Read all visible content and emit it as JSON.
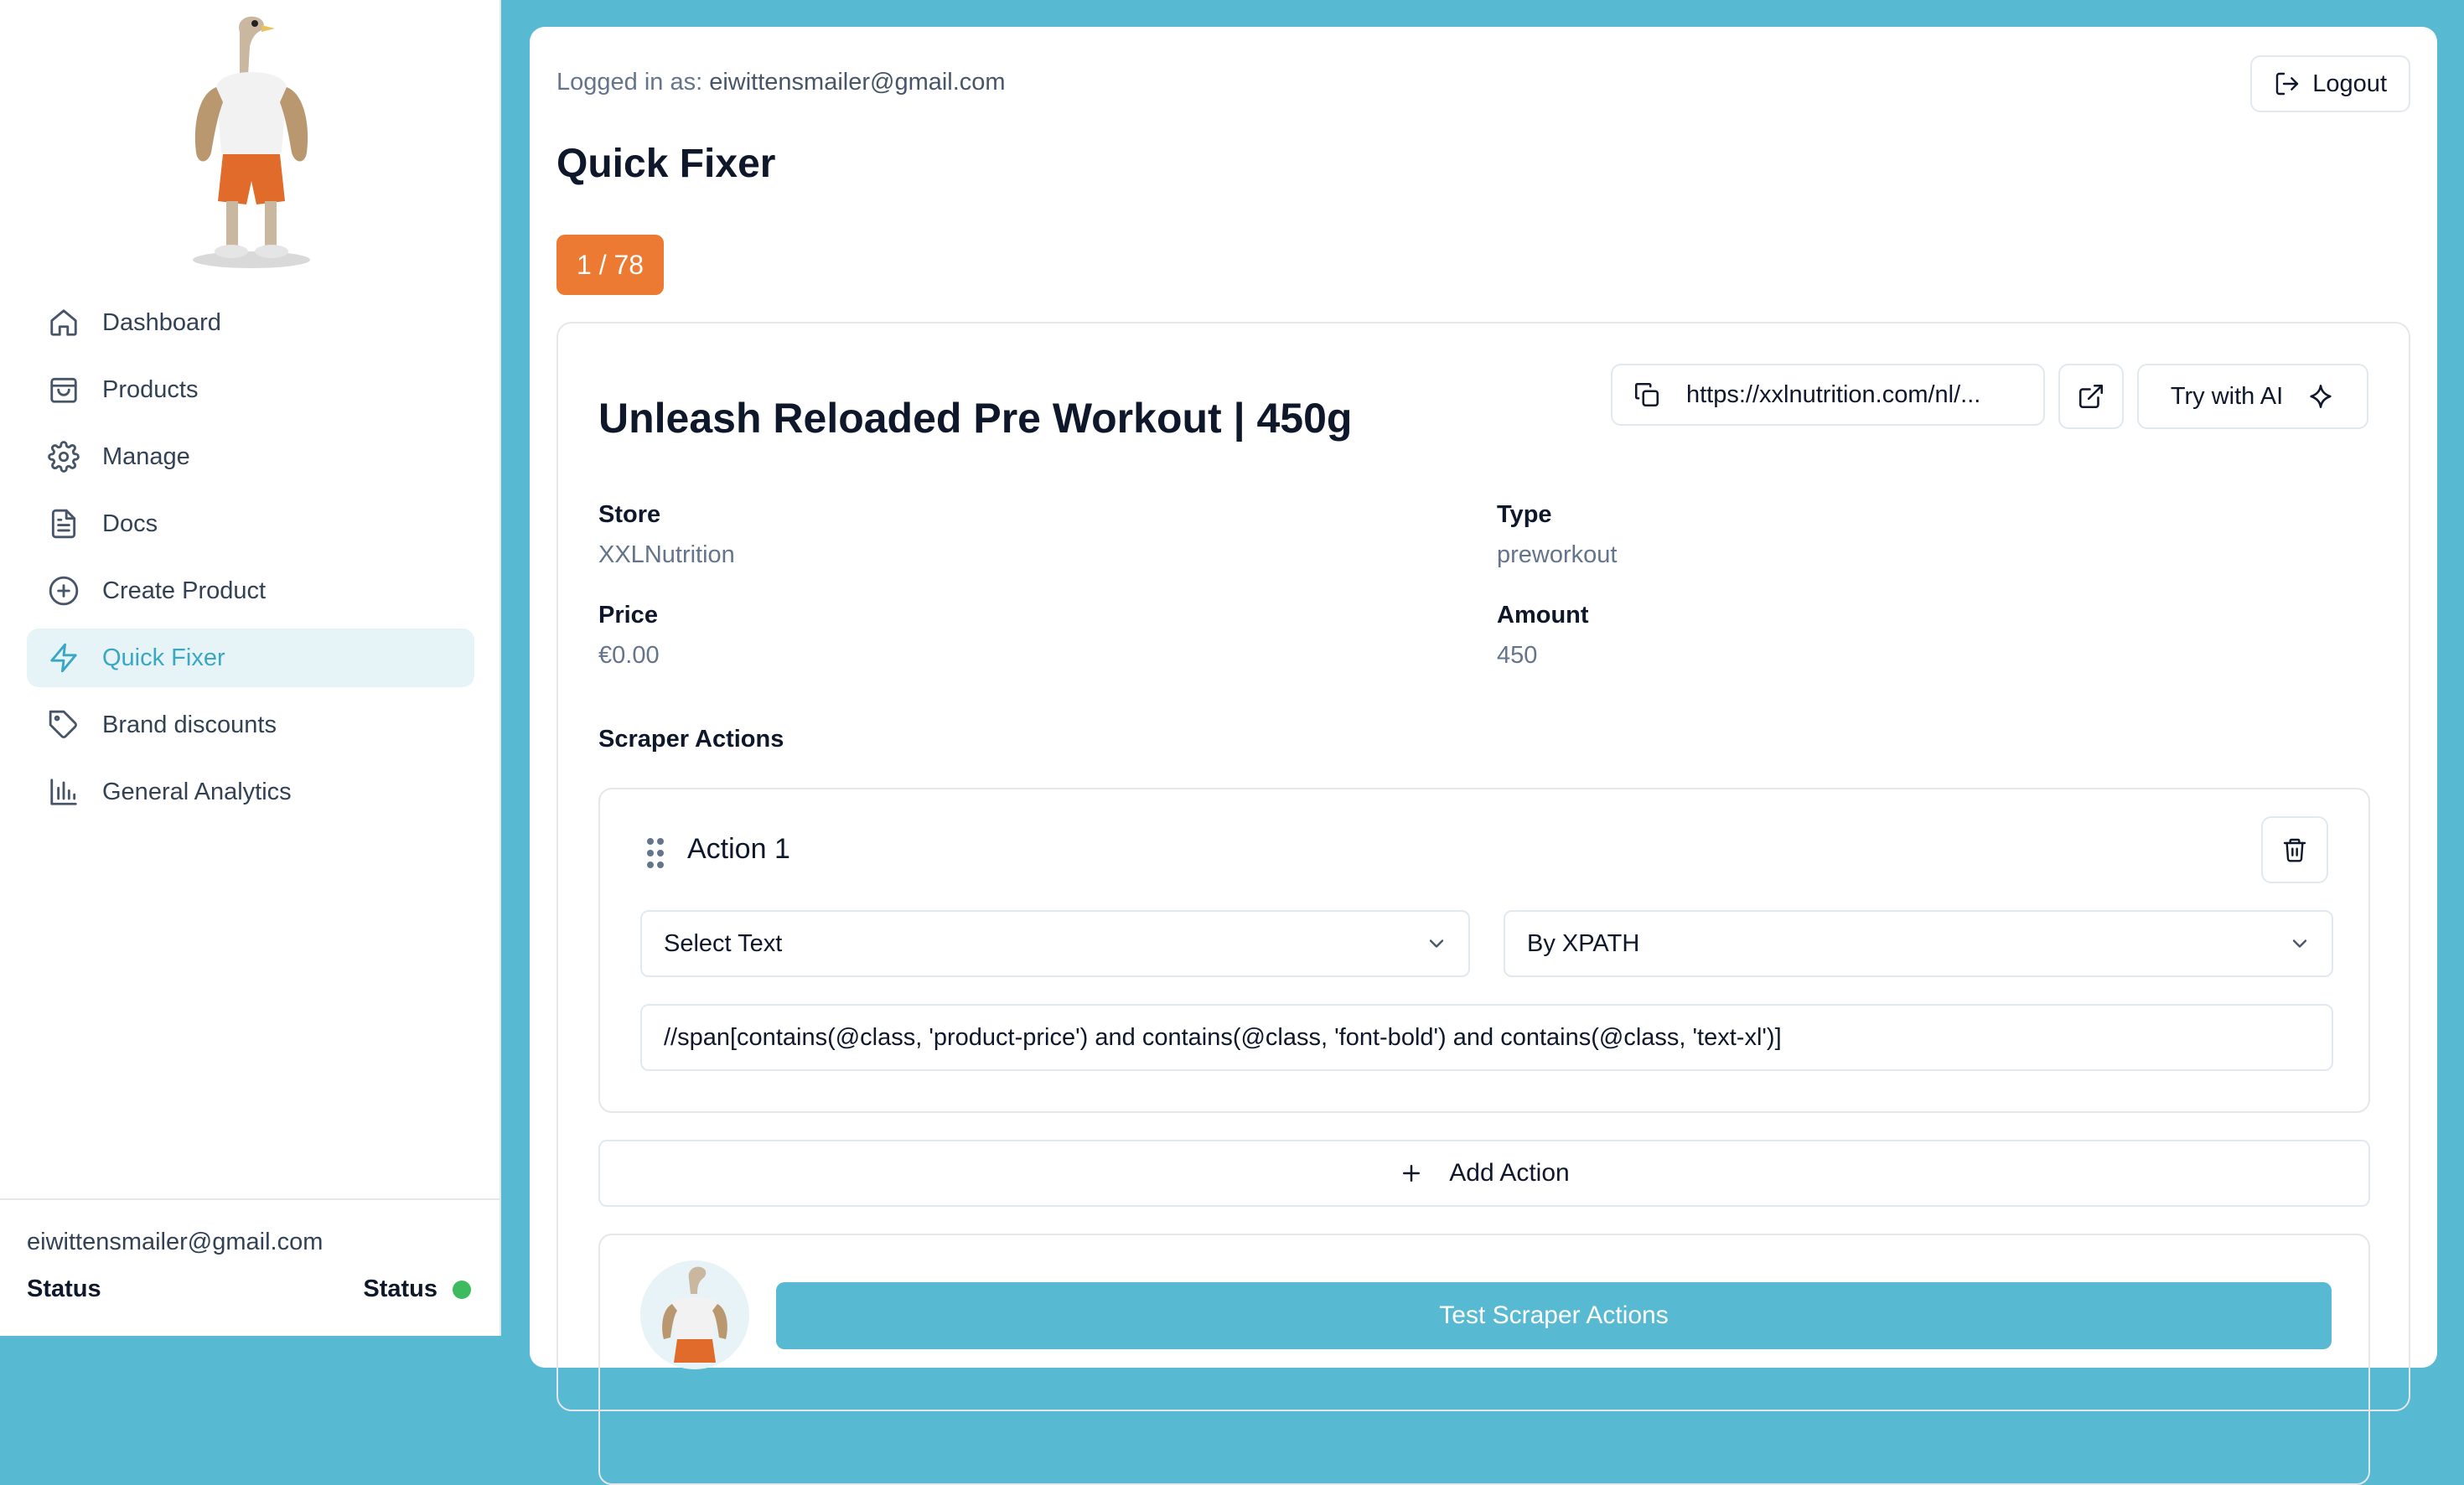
{
  "sidebar": {
    "logo_alt": "ostrich bodybuilder mascot",
    "items": [
      {
        "label": "Dashboard",
        "icon": "home-icon"
      },
      {
        "label": "Products",
        "icon": "shopping-bag-icon"
      },
      {
        "label": "Manage",
        "icon": "gear-icon"
      },
      {
        "label": "Docs",
        "icon": "document-icon"
      },
      {
        "label": "Create Product",
        "icon": "plus-circle-icon"
      },
      {
        "label": "Quick Fixer",
        "icon": "lightning-icon",
        "active": true
      },
      {
        "label": "Brand discounts",
        "icon": "tag-icon"
      },
      {
        "label": "General Analytics",
        "icon": "bar-chart-icon"
      }
    ],
    "footer": {
      "email": "eiwittensmailer@gmail.com",
      "status_left": "Status",
      "status_right": "Status",
      "status_color": "#3dbb5e"
    }
  },
  "header": {
    "logged_prefix": "Logged in as:",
    "logged_email": "eiwittensmailer@gmail.com",
    "logout_label": "Logout"
  },
  "page": {
    "title": "Quick Fixer",
    "counter": "1 / 78",
    "counter_color": "#ec7a33"
  },
  "product": {
    "title": "Unleash Reloaded Pre Workout | 450g",
    "url": "https://xxlnutrition.com/nl/...",
    "try_ai_label": "Try with AI",
    "store_label": "Store",
    "store_value": "XXLNutrition",
    "type_label": "Type",
    "type_value": "preworkout",
    "price_label": "Price",
    "price_value": "€0.00",
    "amount_label": "Amount",
    "amount_value": "450"
  },
  "scraper": {
    "section_label": "Scraper Actions",
    "actions": [
      {
        "title": "Action 1",
        "action_type": "Select Text",
        "selector_type": "By XPATH",
        "selector": "//span[contains(@class, 'product-price') and contains(@class, 'font-bold') and contains(@class, 'text-xl')]"
      }
    ],
    "add_action_label": "Add Action",
    "test_button_label": "Test Scraper Actions"
  },
  "theme": {
    "accent": "#58b9d3",
    "active_nav_bg": "#e6f4f7",
    "active_nav_text": "#3aa7c4"
  }
}
